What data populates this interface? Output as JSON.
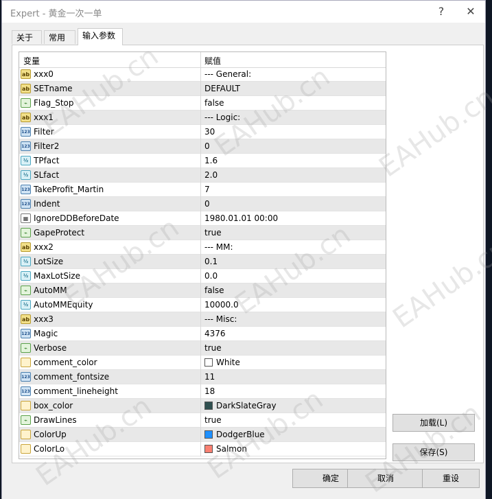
{
  "window": {
    "title": "Expert - 黄金一次一单",
    "help_label": "?",
    "close_label": "✕"
  },
  "tabs": [
    {
      "label": "关于"
    },
    {
      "label": "常用"
    },
    {
      "label": "输入参数"
    }
  ],
  "table": {
    "headers": {
      "variable": "变量",
      "value": "赋值"
    },
    "rows": [
      {
        "icon": "ab",
        "name": "xxx0",
        "value": "--- General:"
      },
      {
        "icon": "ab",
        "name": "SETname",
        "value": "DEFAULT"
      },
      {
        "icon": "bool",
        "name": "Flag_Stop",
        "value": "false"
      },
      {
        "icon": "ab",
        "name": "xxx1",
        "value": "--- Logic:"
      },
      {
        "icon": "123",
        "name": "Filter",
        "value": "30"
      },
      {
        "icon": "123",
        "name": "Filter2",
        "value": "0"
      },
      {
        "icon": "v2",
        "name": "TPfact",
        "value": "1.6"
      },
      {
        "icon": "v2",
        "name": "SLfact",
        "value": "2.0"
      },
      {
        "icon": "123",
        "name": "TakeProfit_Martin",
        "value": "7"
      },
      {
        "icon": "123",
        "name": "Indent",
        "value": "0"
      },
      {
        "icon": "date",
        "name": "IgnoreDDBeforeDate",
        "value": "1980.01.01 00:00"
      },
      {
        "icon": "bool",
        "name": "GapeProtect",
        "value": "true"
      },
      {
        "icon": "ab",
        "name": "xxx2",
        "value": "--- MM:"
      },
      {
        "icon": "v2",
        "name": "LotSize",
        "value": "0.1"
      },
      {
        "icon": "v2",
        "name": "MaxLotSize",
        "value": "0.0"
      },
      {
        "icon": "bool",
        "name": "AutoMM",
        "value": "false"
      },
      {
        "icon": "v2",
        "name": "AutoMMEquity",
        "value": "10000.0"
      },
      {
        "icon": "ab",
        "name": "xxx3",
        "value": "--- Misc:"
      },
      {
        "icon": "123",
        "name": "Magic",
        "value": "4376"
      },
      {
        "icon": "bool",
        "name": "Verbose",
        "value": "true"
      },
      {
        "icon": "color",
        "name": "comment_color",
        "value": "White",
        "swatch": "#ffffff"
      },
      {
        "icon": "123",
        "name": "comment_fontsize",
        "value": "11"
      },
      {
        "icon": "123",
        "name": "comment_lineheight",
        "value": "18"
      },
      {
        "icon": "color",
        "name": "box_color",
        "value": "DarkSlateGray",
        "swatch": "#2f4f4f"
      },
      {
        "icon": "bool",
        "name": "DrawLines",
        "value": "true"
      },
      {
        "icon": "color",
        "name": "ColorUp",
        "value": "DodgerBlue",
        "swatch": "#1e90ff"
      },
      {
        "icon": "color",
        "name": "ColorLo",
        "value": "Salmon",
        "swatch": "#fa8072"
      }
    ]
  },
  "side_buttons": {
    "load": "加载(L)",
    "save": "保存(S)"
  },
  "bottom_buttons": {
    "ok": "确定",
    "cancel": "取消",
    "reset": "重设"
  },
  "watermark": "EAHub.cn",
  "icon_labels": {
    "ab": "ab",
    "123": "123",
    "v2": "½",
    "bool": "⌁",
    "date": "▦",
    "color": ""
  }
}
